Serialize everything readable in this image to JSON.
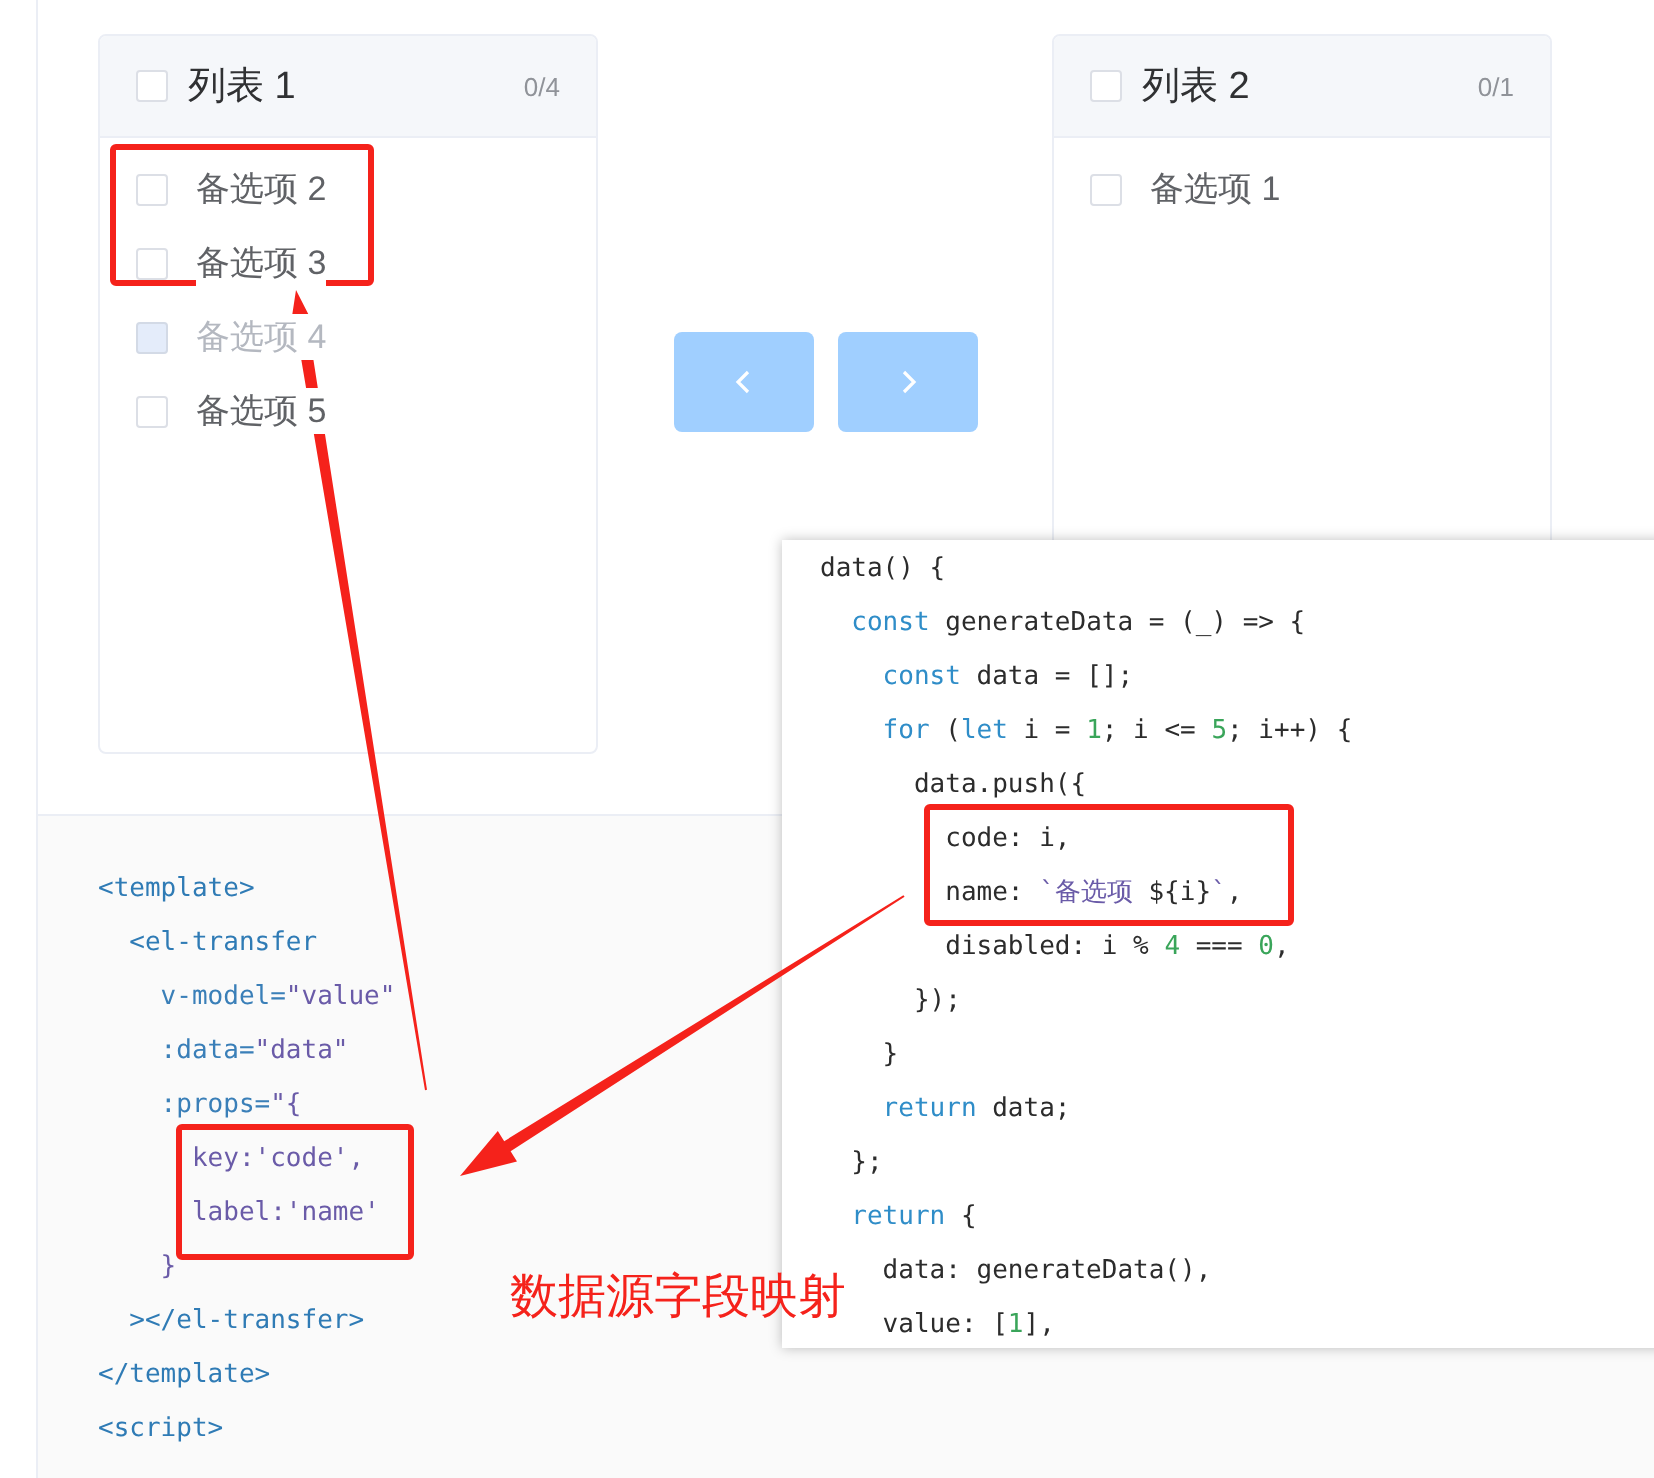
{
  "transfer": {
    "panels": [
      {
        "title": "列表 1",
        "checked": false,
        "count": "0/4",
        "items": [
          {
            "label": "备选项 2",
            "checked": false,
            "disabled": false
          },
          {
            "label": "备选项 3",
            "checked": false,
            "disabled": false
          },
          {
            "label": "备选项 4",
            "checked": false,
            "disabled": true
          },
          {
            "label": "备选项 5",
            "checked": false,
            "disabled": false
          }
        ]
      },
      {
        "title": "列表 2",
        "checked": false,
        "count": "0/1",
        "items": [
          {
            "label": "备选项 1",
            "checked": false,
            "disabled": false
          }
        ]
      }
    ],
    "buttons": [
      {
        "kind": "prev",
        "disabled": true
      },
      {
        "kind": "next",
        "disabled": true
      }
    ]
  },
  "demo_code": [
    [
      {
        "kind": "tag",
        "text": "<template>"
      }
    ],
    [
      {
        "kind": "tag",
        "text": "  <el-transfer"
      }
    ],
    [
      {
        "kind": "attr",
        "text": "    v-model="
      },
      {
        "kind": "string",
        "text": "\"value\""
      }
    ],
    [
      {
        "kind": "attr",
        "text": "    :data="
      },
      {
        "kind": "string",
        "text": "\"data\""
      }
    ],
    [
      {
        "kind": "attr",
        "text": "    :props="
      },
      {
        "kind": "string",
        "text": "\"{"
      }
    ],
    [
      {
        "kind": "string",
        "text": "      key:'code',"
      }
    ],
    [
      {
        "kind": "string",
        "text": "      label:'name'"
      }
    ],
    [
      {
        "kind": "string",
        "text": "    }"
      }
    ],
    [
      {
        "kind": "tag",
        "text": "  ></el-transfer>"
      }
    ],
    [
      {
        "kind": "tag",
        "text": "</template>"
      }
    ],
    [
      {
        "kind": "tag",
        "text": "<script>"
      }
    ]
  ],
  "popup_code": [
    [
      {
        "kind": "plain",
        "text": "data() {"
      }
    ],
    [
      {
        "kind": "keyword",
        "text": "  const"
      },
      {
        "kind": "plain",
        "text": " generateData = (_) => {"
      }
    ],
    [
      {
        "kind": "keyword",
        "text": "    const"
      },
      {
        "kind": "plain",
        "text": " data = [];"
      }
    ],
    [
      {
        "kind": "keyword",
        "text": "    for"
      },
      {
        "kind": "plain",
        "text": " ("
      },
      {
        "kind": "keyword",
        "text": "let"
      },
      {
        "kind": "plain",
        "text": " i = "
      },
      {
        "kind": "number",
        "text": "1"
      },
      {
        "kind": "plain",
        "text": "; i <= "
      },
      {
        "kind": "number",
        "text": "5"
      },
      {
        "kind": "plain",
        "text": "; i++) {"
      }
    ],
    [
      {
        "kind": "plain",
        "text": "      data.push({"
      }
    ],
    [
      {
        "kind": "plain",
        "text": "        code: i,"
      }
    ],
    [
      {
        "kind": "plain",
        "text": "        name: "
      },
      {
        "kind": "string",
        "text": "`备选项 "
      },
      {
        "kind": "plain",
        "text": "${i}"
      },
      {
        "kind": "string",
        "text": "`"
      },
      {
        "kind": "plain",
        "text": ","
      }
    ],
    [
      {
        "kind": "plain",
        "text": "        disabled: i % "
      },
      {
        "kind": "number",
        "text": "4"
      },
      {
        "kind": "plain",
        "text": " === "
      },
      {
        "kind": "number",
        "text": "0"
      },
      {
        "kind": "plain",
        "text": ","
      }
    ],
    [
      {
        "kind": "plain",
        "text": "      });"
      }
    ],
    [
      {
        "kind": "plain",
        "text": "    }"
      }
    ],
    [
      {
        "kind": "keyword",
        "text": "    return"
      },
      {
        "kind": "plain",
        "text": " data;"
      }
    ],
    [
      {
        "kind": "plain",
        "text": "  };"
      }
    ],
    [
      {
        "kind": "keyword",
        "text": "  return"
      },
      {
        "kind": "plain",
        "text": " {"
      }
    ],
    [
      {
        "kind": "plain",
        "text": "    data: generateData(),"
      }
    ],
    [
      {
        "kind": "plain",
        "text": "    value: ["
      },
      {
        "kind": "number",
        "text": "1"
      },
      {
        "kind": "plain",
        "text": "],"
      }
    ]
  ],
  "annotation": {
    "label": "数据源字段映射"
  }
}
